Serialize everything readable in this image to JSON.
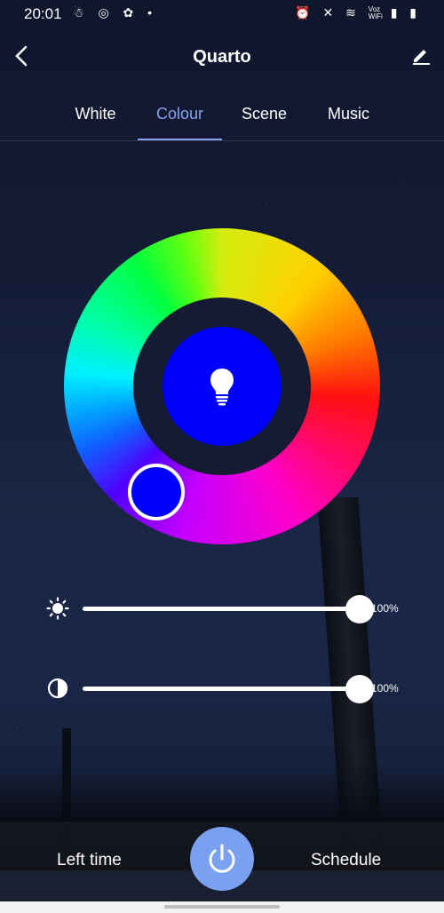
{
  "status_bar": {
    "time": "20:01",
    "left_icons": "☃ ◎ ✿ •",
    "right_icons": "⏰ ✕ ≋",
    "voz_top": "Voz",
    "voz_bottom": "WiFi",
    "signal": "▮ ▮"
  },
  "header": {
    "title": "Quarto",
    "back_icon": "chevron-left-icon",
    "edit_icon": "pencil-icon"
  },
  "tabs": [
    {
      "label": "White",
      "active": false
    },
    {
      "label": "Colour",
      "active": true
    },
    {
      "label": "Scene",
      "active": false
    },
    {
      "label": "Music",
      "active": false
    }
  ],
  "color": {
    "selected_hex": "#0000ff",
    "accent": "#87a2f0"
  },
  "sliders": {
    "brightness": {
      "value_label": "100%",
      "value": 1.0,
      "icon": "sun-icon"
    },
    "saturation": {
      "value_label": "100%",
      "value": 1.0,
      "icon": "contrast-icon"
    }
  },
  "bottom": {
    "left_time_label": "Left time",
    "schedule_label": "Schedule",
    "power_icon": "power-icon",
    "power_color": "#7aa0f0"
  }
}
